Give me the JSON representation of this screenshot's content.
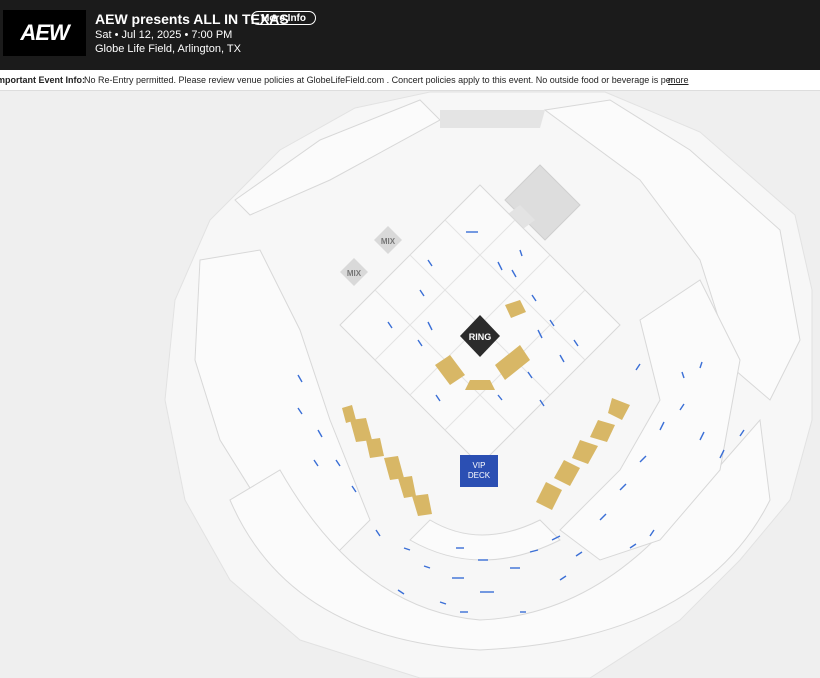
{
  "header": {
    "logo_text": "AEW",
    "title": "AEW presents ALL IN TEXAS",
    "more_info_label": "More Info",
    "date": "Sat • Jul 12, 2025 • 7:00 PM",
    "venue": "Globe Life Field, Arlington, TX"
  },
  "info_bar": {
    "label": "mportant Event Info:",
    "text": "No Re-Entry permitted. Please review venue policies at GlobeLifeField.com . Concert policies apply to this event. No outside food or beverage is per...",
    "more_link": "more"
  },
  "map": {
    "ring_label": "RING",
    "vip_label_line1": "VIP",
    "vip_label_line2": "DECK",
    "mix_label_1": "MIX",
    "mix_label_2": "MIX",
    "colors": {
      "outer": "#f7f7f7",
      "section": "#fafafa",
      "section_stroke": "#dcdcdc",
      "ring": "#2b2b2b",
      "vip": "#2b4fb3",
      "gold": "#d8b766",
      "blue": "#3b6fd6",
      "stage": "#dddddd"
    }
  }
}
